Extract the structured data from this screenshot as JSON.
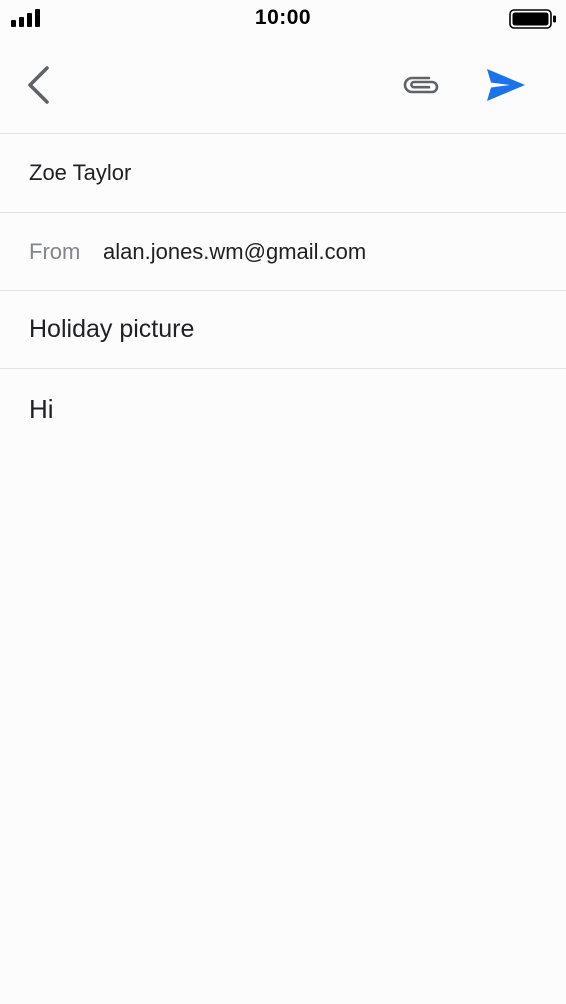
{
  "status_bar": {
    "time": "10:00"
  },
  "toolbar": {
    "back_icon": "chevron-left-icon",
    "attach_icon": "paperclip-icon",
    "send_icon": "send-icon"
  },
  "compose": {
    "to": "Zoe Taylor",
    "from_label": "From",
    "from_value": "alan.jones.wm@gmail.com",
    "subject": "Holiday picture",
    "body": "Hi"
  },
  "colors": {
    "accent": "#1a73e8",
    "icon_gray": "#5f6368",
    "divider": "#e3e3e3",
    "background": "#fcfcfc"
  }
}
